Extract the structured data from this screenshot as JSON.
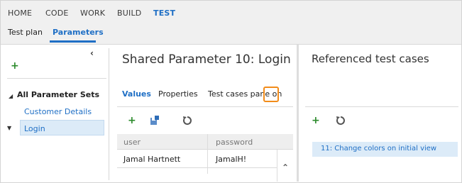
{
  "top_nav": {
    "hubs": [
      "HOME",
      "CODE",
      "WORK",
      "BUILD",
      "TEST"
    ],
    "active_hub": "TEST",
    "subtabs": [
      "Test plan",
      "Parameters"
    ],
    "active_subtab": "Parameters"
  },
  "left_pane": {
    "collapse_icon": "chevron-left-icon",
    "add_icon": "plus-icon",
    "tree": {
      "root_label": "All Parameter Sets",
      "children": [
        "Customer Details",
        "Login"
      ],
      "selected": "Login"
    }
  },
  "middle_pane": {
    "title": "Shared Parameter 10: Login",
    "pivots": [
      "Values",
      "Properties",
      "Test cases pane on"
    ],
    "active_pivot": "Values",
    "toolbar_icons": [
      "plus-icon",
      "save-icon",
      "refresh-icon"
    ],
    "grid": {
      "columns": [
        "user",
        "password"
      ],
      "rows": [
        [
          "Jamal Hartnett",
          "JamalH!"
        ]
      ]
    }
  },
  "right_pane": {
    "title": "Referenced test cases",
    "toolbar_icons": [
      "plus-icon",
      "refresh-icon"
    ],
    "items": [
      "11: Change colors on initial view"
    ]
  },
  "colors": {
    "accent": "#1f6fc5",
    "highlight": "#f28c1a",
    "selection": "#dcebf8",
    "add_green": "#2b8a2b"
  }
}
